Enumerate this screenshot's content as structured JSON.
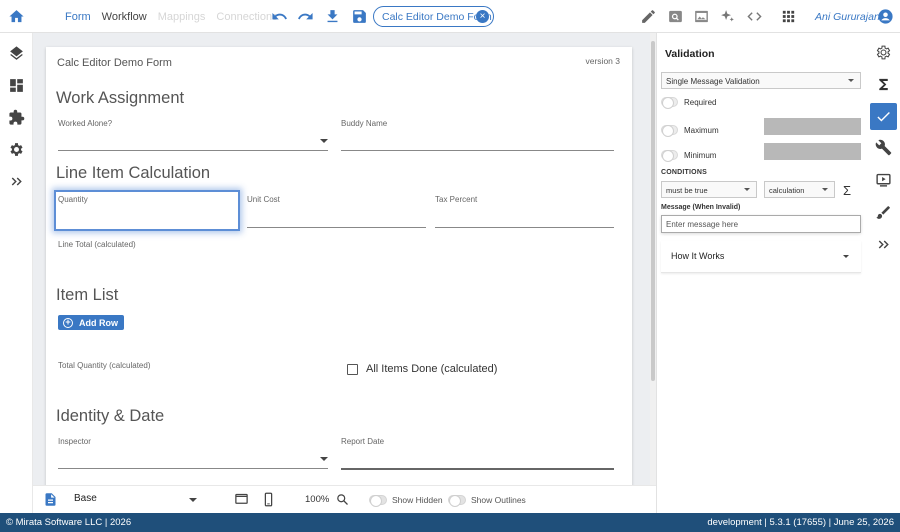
{
  "colors": {
    "accent": "#3a78c4",
    "footer_bg": "#1f4f7a",
    "canvas_bg": "#eceef1"
  },
  "topbar": {
    "nav": [
      {
        "label": "Form",
        "state": "active"
      },
      {
        "label": "Workflow",
        "state": "normal"
      },
      {
        "label": "Mappings",
        "state": "faded"
      },
      {
        "label": "Connections",
        "state": "faded"
      }
    ],
    "form_chip": "Calc Editor Demo Form",
    "user_name": "Ani Gururajan",
    "icons": [
      "home-icon",
      "undo-icon",
      "redo-icon",
      "download-icon",
      "save-icon",
      "pencil-icon",
      "preview-icon",
      "image-icon",
      "sparkle-icon",
      "code-icon",
      "apps-grid-icon",
      "account-icon"
    ]
  },
  "leftrail": {
    "icons": [
      "layers-icon",
      "dashboard-icon",
      "puzzle-icon",
      "settings-icon",
      "expand-icon"
    ]
  },
  "form": {
    "title": "Calc Editor Demo Form",
    "version": "version 3",
    "sections": {
      "work": "Work Assignment",
      "calc": "Line Item Calculation",
      "list": "Item List",
      "identity": "Identity & Date"
    },
    "fields": {
      "worked_alone": "Worked Alone?",
      "buddy_name": "Buddy Name",
      "quantity": "Quantity",
      "unit_cost": "Unit Cost",
      "tax_percent": "Tax Percent",
      "line_total": "Line Total (calculated)",
      "total_quantity": "Total Quantity (calculated)",
      "all_items_done": "All Items Done (calculated)",
      "inspector": "Inspector",
      "report_date": "Report Date"
    },
    "add_row_label": "Add Row"
  },
  "bottombar": {
    "layout_select": "Base",
    "zoom": "100%",
    "show_hidden": "Show Hidden",
    "show_outlines": "Show Outlines"
  },
  "validation_panel": {
    "title": "Validation",
    "mode": "Single Message Validation",
    "required": "Required",
    "maximum": "Maximum",
    "minimum": "Minimum",
    "conditions_label": "CONDITIONS",
    "condition_op": "must be true",
    "condition_type": "calculation",
    "message_label": "Message (When Invalid)",
    "message_placeholder": "Enter message here",
    "how_it_works": "How It Works"
  },
  "rightrail": {
    "icons": [
      "gear-icon",
      "sigma-icon",
      "check-icon",
      "wrench-icon",
      "play-icon",
      "brush-icon",
      "expand-icon"
    ],
    "active": "check-icon"
  },
  "footer": {
    "left": "© Mirata Software LLC | 2026",
    "right": "development | 5.3.1 (17655) | June 25, 2026"
  }
}
